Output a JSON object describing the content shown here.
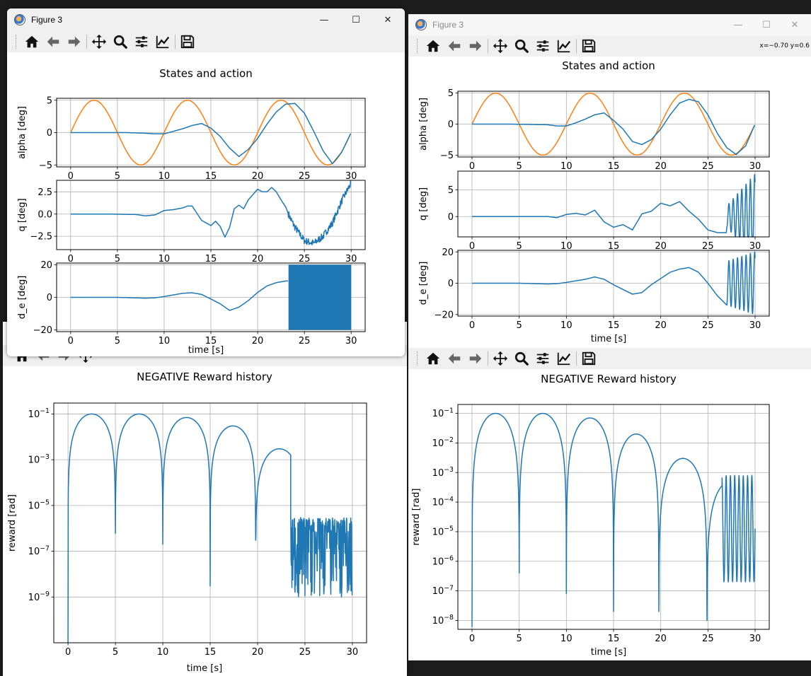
{
  "windows": {
    "top_left": {
      "title": "Figure 3",
      "controls": [
        "—",
        "☐",
        "✕"
      ]
    },
    "top_right": {
      "title": "Figure 3",
      "coords": "x=−0.70 y=0.6",
      "controls": [
        "—",
        "☐",
        "✕"
      ]
    }
  },
  "toolbar": {
    "home": "home-icon",
    "back": "arrow-left-icon",
    "forward": "arrow-right-icon",
    "pan": "move-icon",
    "zoom": "zoom-icon",
    "subplots": "sliders-icon",
    "axes": "chart-line-icon",
    "save": "save-icon"
  },
  "colors": {
    "blue": "#1f77b4",
    "orange": "#ff7f0e",
    "grid": "#b0b0b0"
  },
  "chart_data": [
    {
      "id": "left_states",
      "type": "line",
      "title": "States and action",
      "xlabel": "time [s]",
      "subplots": [
        {
          "ylabel": "alpha [deg]",
          "ylim": [
            -5.3,
            5.3
          ],
          "yticks": [
            5,
            0,
            -5
          ],
          "xlim": [
            -1.5,
            31.5
          ],
          "xticks": [
            0,
            5,
            10,
            15,
            20,
            25,
            30
          ],
          "series": [
            {
              "color": "#ff7f0e",
              "generator": "sine",
              "amp": 5,
              "period": 10,
              "x": [
                0,
                30
              ]
            },
            {
              "color": "#1f77b4",
              "x": [
                0,
                2,
                4,
                6,
                8,
                9,
                10,
                11,
                12,
                13,
                14,
                15,
                16,
                17,
                18,
                19,
                20,
                21,
                22,
                23,
                24,
                25,
                26,
                27,
                28,
                29,
                30
              ],
              "y": [
                0,
                0,
                0,
                0,
                -0.1,
                -0.2,
                -0.2,
                0.2,
                0.6,
                1.1,
                1.4,
                0.7,
                -0.6,
                -2.4,
                -3.7,
                -2.6,
                -0.9,
                1.3,
                3.2,
                4.4,
                4.5,
                3.0,
                0.2,
                -2.8,
                -4.8,
                -3.0,
                0
              ]
            }
          ]
        },
        {
          "ylabel": "q [deg]",
          "ylim": [
            -4.0,
            3.8
          ],
          "yticks": [
            2.5,
            0.0,
            -2.5
          ],
          "ytickfmt": 1,
          "xlim": [
            -1.5,
            31.5
          ],
          "xticks": [
            0,
            5,
            10,
            15,
            20,
            25,
            30
          ],
          "series": [
            {
              "color": "#1f77b4",
              "x": [
                0,
                4,
                7,
                8,
                9,
                10,
                11,
                12,
                12.5,
                13,
                14,
                15,
                15.5,
                16,
                16.5,
                17,
                17.5,
                18,
                18.5,
                19,
                19.5,
                20,
                20.5,
                21,
                21.5,
                22,
                22.5,
                23,
                23.5,
                24,
                25,
                26,
                27,
                28,
                29,
                30
              ],
              "y": [
                0,
                0,
                -0.05,
                -0.2,
                -0.1,
                0.4,
                0.5,
                0.7,
                0.9,
                0.9,
                -0.7,
                -1.3,
                -0.8,
                -1.4,
                -2.6,
                -1.5,
                0.6,
                1.0,
                0.6,
                1.6,
                2.2,
                2.8,
                2.5,
                2.5,
                3.0,
                2.5,
                1.6,
                0.8,
                -0.5,
                -1.5,
                -3.0,
                -3.3,
                -2.5,
                -1.0,
                1.5,
                3.5
              ],
              "noise": {
                "from": 23.3,
                "amp": 0.4
              }
            }
          ]
        },
        {
          "ylabel": "d_e [deg]",
          "ylim": [
            -21,
            21
          ],
          "yticks": [
            20,
            0,
            -20
          ],
          "xlim": [
            -1.5,
            31.5
          ],
          "xticks": [
            0,
            5,
            10,
            15,
            20,
            25,
            30
          ],
          "series": [
            {
              "color": "#1f77b4",
              "x": [
                0,
                5,
                8,
                9,
                10,
                11,
                12,
                13,
                14,
                15,
                16,
                17,
                17.5,
                18,
                19,
                20,
                21,
                22,
                23,
                23.3
              ],
              "y": [
                0,
                0,
                -0.5,
                -0.3,
                0.5,
                1.5,
                2.5,
                2.8,
                1.8,
                -1.0,
                -4,
                -8,
                -7,
                -6,
                -2,
                3,
                7,
                9,
                10,
                10
              ],
              "band": {
                "from": 23.3,
                "to": 30,
                "min": -20,
                "max": 20
              }
            }
          ]
        }
      ]
    },
    {
      "id": "left_reward",
      "type": "line",
      "title": "NEGATIVE Reward history",
      "xlabel": "time [s]",
      "ylabel": "reward [rad]",
      "yscale": "log",
      "ylim": [
        1e-11,
        0.3
      ],
      "yticks": [
        0.1,
        0.001,
        1e-05,
        1e-07,
        1e-09
      ],
      "ytick_labels": [
        [
          "10",
          "−1"
        ],
        [
          "10",
          "−3"
        ],
        [
          "10",
          "−5"
        ],
        [
          "10",
          "−7"
        ],
        [
          "10",
          "−9"
        ]
      ],
      "xlim": [
        -1.5,
        31.5
      ],
      "xticks": [
        0,
        5,
        10,
        15,
        20,
        25,
        30
      ],
      "series": [
        {
          "color": "#1f77b4",
          "generator": "reward",
          "peaks": [
            0.1,
            0.1,
            0.07,
            0.03,
            0.003
          ],
          "dips": [
            0,
            5,
            10,
            15,
            19.8
          ],
          "dip_min": [
            1e-11,
            6e-07,
            2e-07,
            3e-09,
            3e-07
          ],
          "noise_from": 23.5,
          "noise_center": 3e-07,
          "noise_low": 1e-09
        }
      ]
    },
    {
      "id": "right_states",
      "type": "line",
      "title": "States and action",
      "xlabel": "time [s]",
      "subplots": [
        {
          "ylabel": "alpha [deg]",
          "ylim": [
            -5.3,
            5.3
          ],
          "yticks": [
            5,
            0,
            -5
          ],
          "xlim": [
            -1.5,
            31.5
          ],
          "xticks": [
            0,
            5,
            10,
            15,
            20,
            25,
            30
          ],
          "series": [
            {
              "color": "#ff7f0e",
              "generator": "sine",
              "amp": 5,
              "period": 10,
              "x": [
                0,
                30
              ]
            },
            {
              "color": "#1f77b4",
              "x": [
                0,
                4,
                8,
                9,
                10,
                11,
                12,
                13,
                14,
                15,
                16,
                17,
                18,
                19,
                20,
                21,
                22,
                23,
                24,
                25,
                26,
                27,
                28,
                29,
                30
              ],
              "y": [
                0,
                0,
                -0.1,
                -0.3,
                -0.3,
                0.2,
                0.8,
                1.5,
                1.8,
                0.6,
                -0.8,
                -2.8,
                -3.3,
                -2.5,
                -0.8,
                1.5,
                3.4,
                4.0,
                3.6,
                1.5,
                -1.5,
                -3.8,
                -4.9,
                -3.5,
                0
              ]
            }
          ]
        },
        {
          "ylabel": "q [deg]",
          "ylim": [
            -3.8,
            8.5
          ],
          "yticks": [
            5,
            0
          ],
          "xlim": [
            -1.5,
            31.5
          ],
          "xticks": [
            0,
            5,
            10,
            15,
            20,
            25,
            30
          ],
          "series": [
            {
              "color": "#1f77b4",
              "x": [
                0,
                4,
                8,
                9,
                10,
                11,
                12,
                13,
                14,
                15,
                16,
                17,
                18,
                19,
                20,
                21,
                22,
                23,
                24,
                25,
                26,
                27
              ],
              "y": [
                0,
                0,
                0,
                -0.2,
                0.4,
                0.6,
                0.3,
                1.2,
                -1.0,
                -2.0,
                -1.5,
                -2.5,
                0.5,
                1.0,
                2.5,
                2.0,
                2.8,
                1.0,
                -0.5,
                -2.5,
                -3.0,
                -3.0
              ],
              "osc": {
                "from": 27,
                "to": 30,
                "amp_from": 2,
                "amp_to": 8,
                "freq": 2.2
              }
            }
          ]
        },
        {
          "ylabel": "d_e [deg]",
          "ylim": [
            -21,
            21
          ],
          "yticks": [
            20,
            0,
            -20
          ],
          "xlim": [
            -1.5,
            31.5
          ],
          "xticks": [
            0,
            5,
            10,
            15,
            20,
            25,
            30
          ],
          "series": [
            {
              "color": "#1f77b4",
              "x": [
                0,
                5,
                8,
                9,
                10,
                11,
                12,
                13,
                14,
                15,
                16,
                17,
                18,
                19,
                20,
                21,
                22,
                23,
                24,
                25,
                26,
                27
              ],
              "y": [
                0,
                0,
                -0.5,
                -0.3,
                0.5,
                1.5,
                2.5,
                4,
                2.5,
                -1,
                -4,
                -7,
                -6,
                -1,
                3,
                7,
                9,
                10,
                7,
                0,
                -8,
                -14
              ],
              "osc": {
                "from": 27,
                "to": 30,
                "amp_from": 14,
                "amp_to": 20,
                "freq": 2.2,
                "clip": 20
              }
            }
          ]
        }
      ]
    },
    {
      "id": "right_reward",
      "type": "line",
      "title": "NEGATIVE Reward history",
      "xlabel": "time [s]",
      "ylabel": "reward [rad]",
      "yscale": "log",
      "ylim": [
        5e-09,
        0.2
      ],
      "yticks": [
        0.1,
        0.01,
        0.001,
        0.0001,
        1e-05,
        1e-06,
        1e-07,
        1e-08
      ],
      "ytick_labels": [
        [
          "10",
          "−1"
        ],
        [
          "10",
          "−2"
        ],
        [
          "10",
          "−3"
        ],
        [
          "10",
          "−4"
        ],
        [
          "10",
          "−5"
        ],
        [
          "10",
          "−6"
        ],
        [
          "10",
          "−7"
        ],
        [
          "10",
          "−8"
        ]
      ],
      "xlim": [
        -1.5,
        31.5
      ],
      "xticks": [
        0,
        5,
        10,
        15,
        20,
        25,
        30
      ],
      "series": [
        {
          "color": "#1f77b4",
          "generator": "reward",
          "peaks": [
            0.1,
            0.1,
            0.07,
            0.02,
            0.003,
            0.0005
          ],
          "dips": [
            0,
            5,
            10,
            15,
            19.8,
            24.9
          ],
          "dip_min": [
            6e-09,
            4e-07,
            8e-08,
            2e-08,
            2e-08,
            1e-08
          ],
          "osc_from": 26.5,
          "osc_hi": 0.0008,
          "osc_low": 2e-07
        }
      ]
    }
  ]
}
